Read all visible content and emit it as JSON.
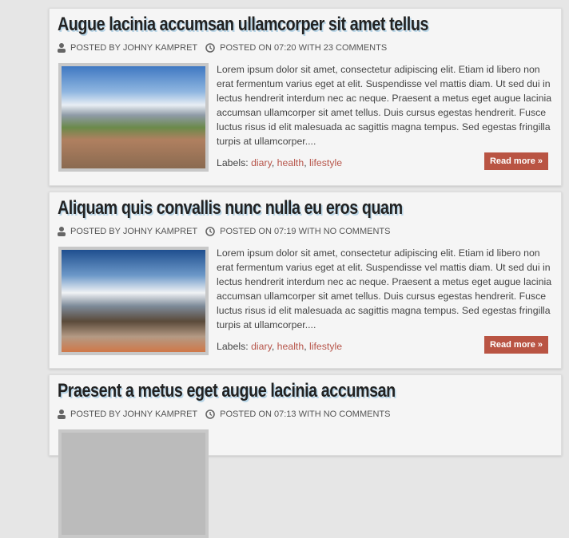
{
  "posts": [
    {
      "title": "Augue lacinia accumsan ullamcorper sit amet tellus",
      "author": "POSTED BY JOHNY KAMPRET",
      "posted": "POSTED ON 07:20 WITH 23 COMMENTS",
      "body": "Lorem ipsum dolor sit amet, consectetur adipiscing elit. Etiam id libero non erat fermentum varius eget at elit. Suspendisse vel mattis diam. Ut sed dui in lectus hendrerit interdum nec ac neque. Praesent a metus eget augue lacinia accumsan ullamcorper sit amet tellus. Duis cursus egestas hendrerit. Fusce luctus risus id elit malesuada ac sagittis magna tempus. Sed egestas fringilla turpis at ullamcorper....",
      "labels_prefix": "Labels:",
      "labels": [
        "diary",
        "health",
        "lifestyle"
      ],
      "read_more": "Read more »"
    },
    {
      "title": "Aliquam quis convallis nunc nulla eu eros quam",
      "author": "POSTED BY JOHNY KAMPRET",
      "posted": "POSTED ON 07:19 WITH NO COMMENTS",
      "body": "Lorem ipsum dolor sit amet, consectetur adipiscing elit. Etiam id libero non erat fermentum varius eget at elit. Suspendisse vel mattis diam. Ut sed dui in lectus hendrerit interdum nec ac neque. Praesent a metus eget augue lacinia accumsan ullamcorper sit amet tellus. Duis cursus egestas hendrerit. Fusce luctus risus id elit malesuada ac sagittis magna tempus. Sed egestas fringilla turpis at ullamcorper....",
      "labels_prefix": "Labels:",
      "labels": [
        "diary",
        "health",
        "lifestyle"
      ],
      "read_more": "Read more »"
    },
    {
      "title": "Praesent a metus eget augue lacinia accumsan",
      "author": "POSTED BY JOHNY KAMPRET",
      "posted": "POSTED ON 07:13 WITH NO COMMENTS"
    }
  ]
}
